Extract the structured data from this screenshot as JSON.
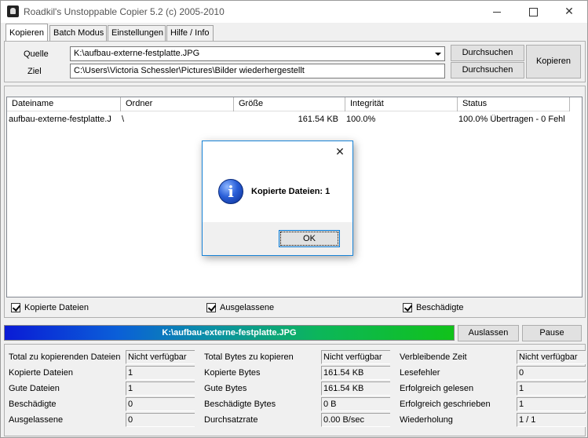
{
  "window": {
    "title": "Roadkil's Unstoppable Copier 5.2 (c) 2005-2010",
    "close_glyph": "✕"
  },
  "tabs": [
    "Kopieren",
    "Batch Modus",
    "Einstellungen",
    "Hilfe / Info"
  ],
  "source": {
    "label": "Quelle",
    "value": "K:\\aufbau-externe-festplatte.JPG"
  },
  "target": {
    "label": "Ziel",
    "value": "C:\\Users\\Victoria Schessler\\Pictures\\Bilder wiederhergestellt"
  },
  "buttons": {
    "browse_source": "Durchsuchen",
    "browse_target": "Durchsuchen",
    "copy": "Kopieren",
    "skip": "Auslassen",
    "pause": "Pause"
  },
  "table": {
    "columns": [
      "Dateiname",
      "Ordner",
      "Größe",
      "Integrität",
      "Status"
    ],
    "rows": [
      {
        "filename": "aufbau-externe-festplatte.J",
        "folder": "\\",
        "size": "161.54 KB",
        "integrity": "100.0%",
        "status": "100.0% Übertragen - 0 Fehl"
      }
    ]
  },
  "filters": {
    "copied": "Kopierte Dateien",
    "skipped": "Ausgelassene",
    "damaged": "Beschädigte"
  },
  "progress": {
    "label": "K:\\aufbau-externe-festplatte.JPG"
  },
  "stats": {
    "col1": [
      {
        "label": "Total zu kopierenden Dateien",
        "value": "Nicht verfügbar"
      },
      {
        "label": "Kopierte Dateien",
        "value": "1"
      },
      {
        "label": "Gute Dateien",
        "value": "1"
      },
      {
        "label": "Beschädigte",
        "value": "0"
      },
      {
        "label": "Ausgelassene",
        "value": "0"
      }
    ],
    "col2": [
      {
        "label": "Total Bytes zu kopieren",
        "value": "Nicht verfügbar"
      },
      {
        "label": "Kopierte Bytes",
        "value": "161.54 KB"
      },
      {
        "label": "Gute Bytes",
        "value": "161.54 KB"
      },
      {
        "label": "Beschädigte Bytes",
        "value": "0 B"
      },
      {
        "label": "Durchsatzrate",
        "value": "0.00 B/sec"
      }
    ],
    "col3": [
      {
        "label": "Verbleibende Zeit",
        "value": "Nicht verfügbar"
      },
      {
        "label": "Lesefehler",
        "value": "0"
      },
      {
        "label": "Erfolgreich gelesen",
        "value": "1"
      },
      {
        "label": "Erfolgreich geschrieben",
        "value": "1"
      },
      {
        "label": "Wiederholung",
        "value": "1 / 1"
      }
    ]
  },
  "dialog": {
    "message": "Kopierte Dateien: 1",
    "ok": "OK",
    "close_glyph": "✕",
    "icon_glyph": "i"
  }
}
